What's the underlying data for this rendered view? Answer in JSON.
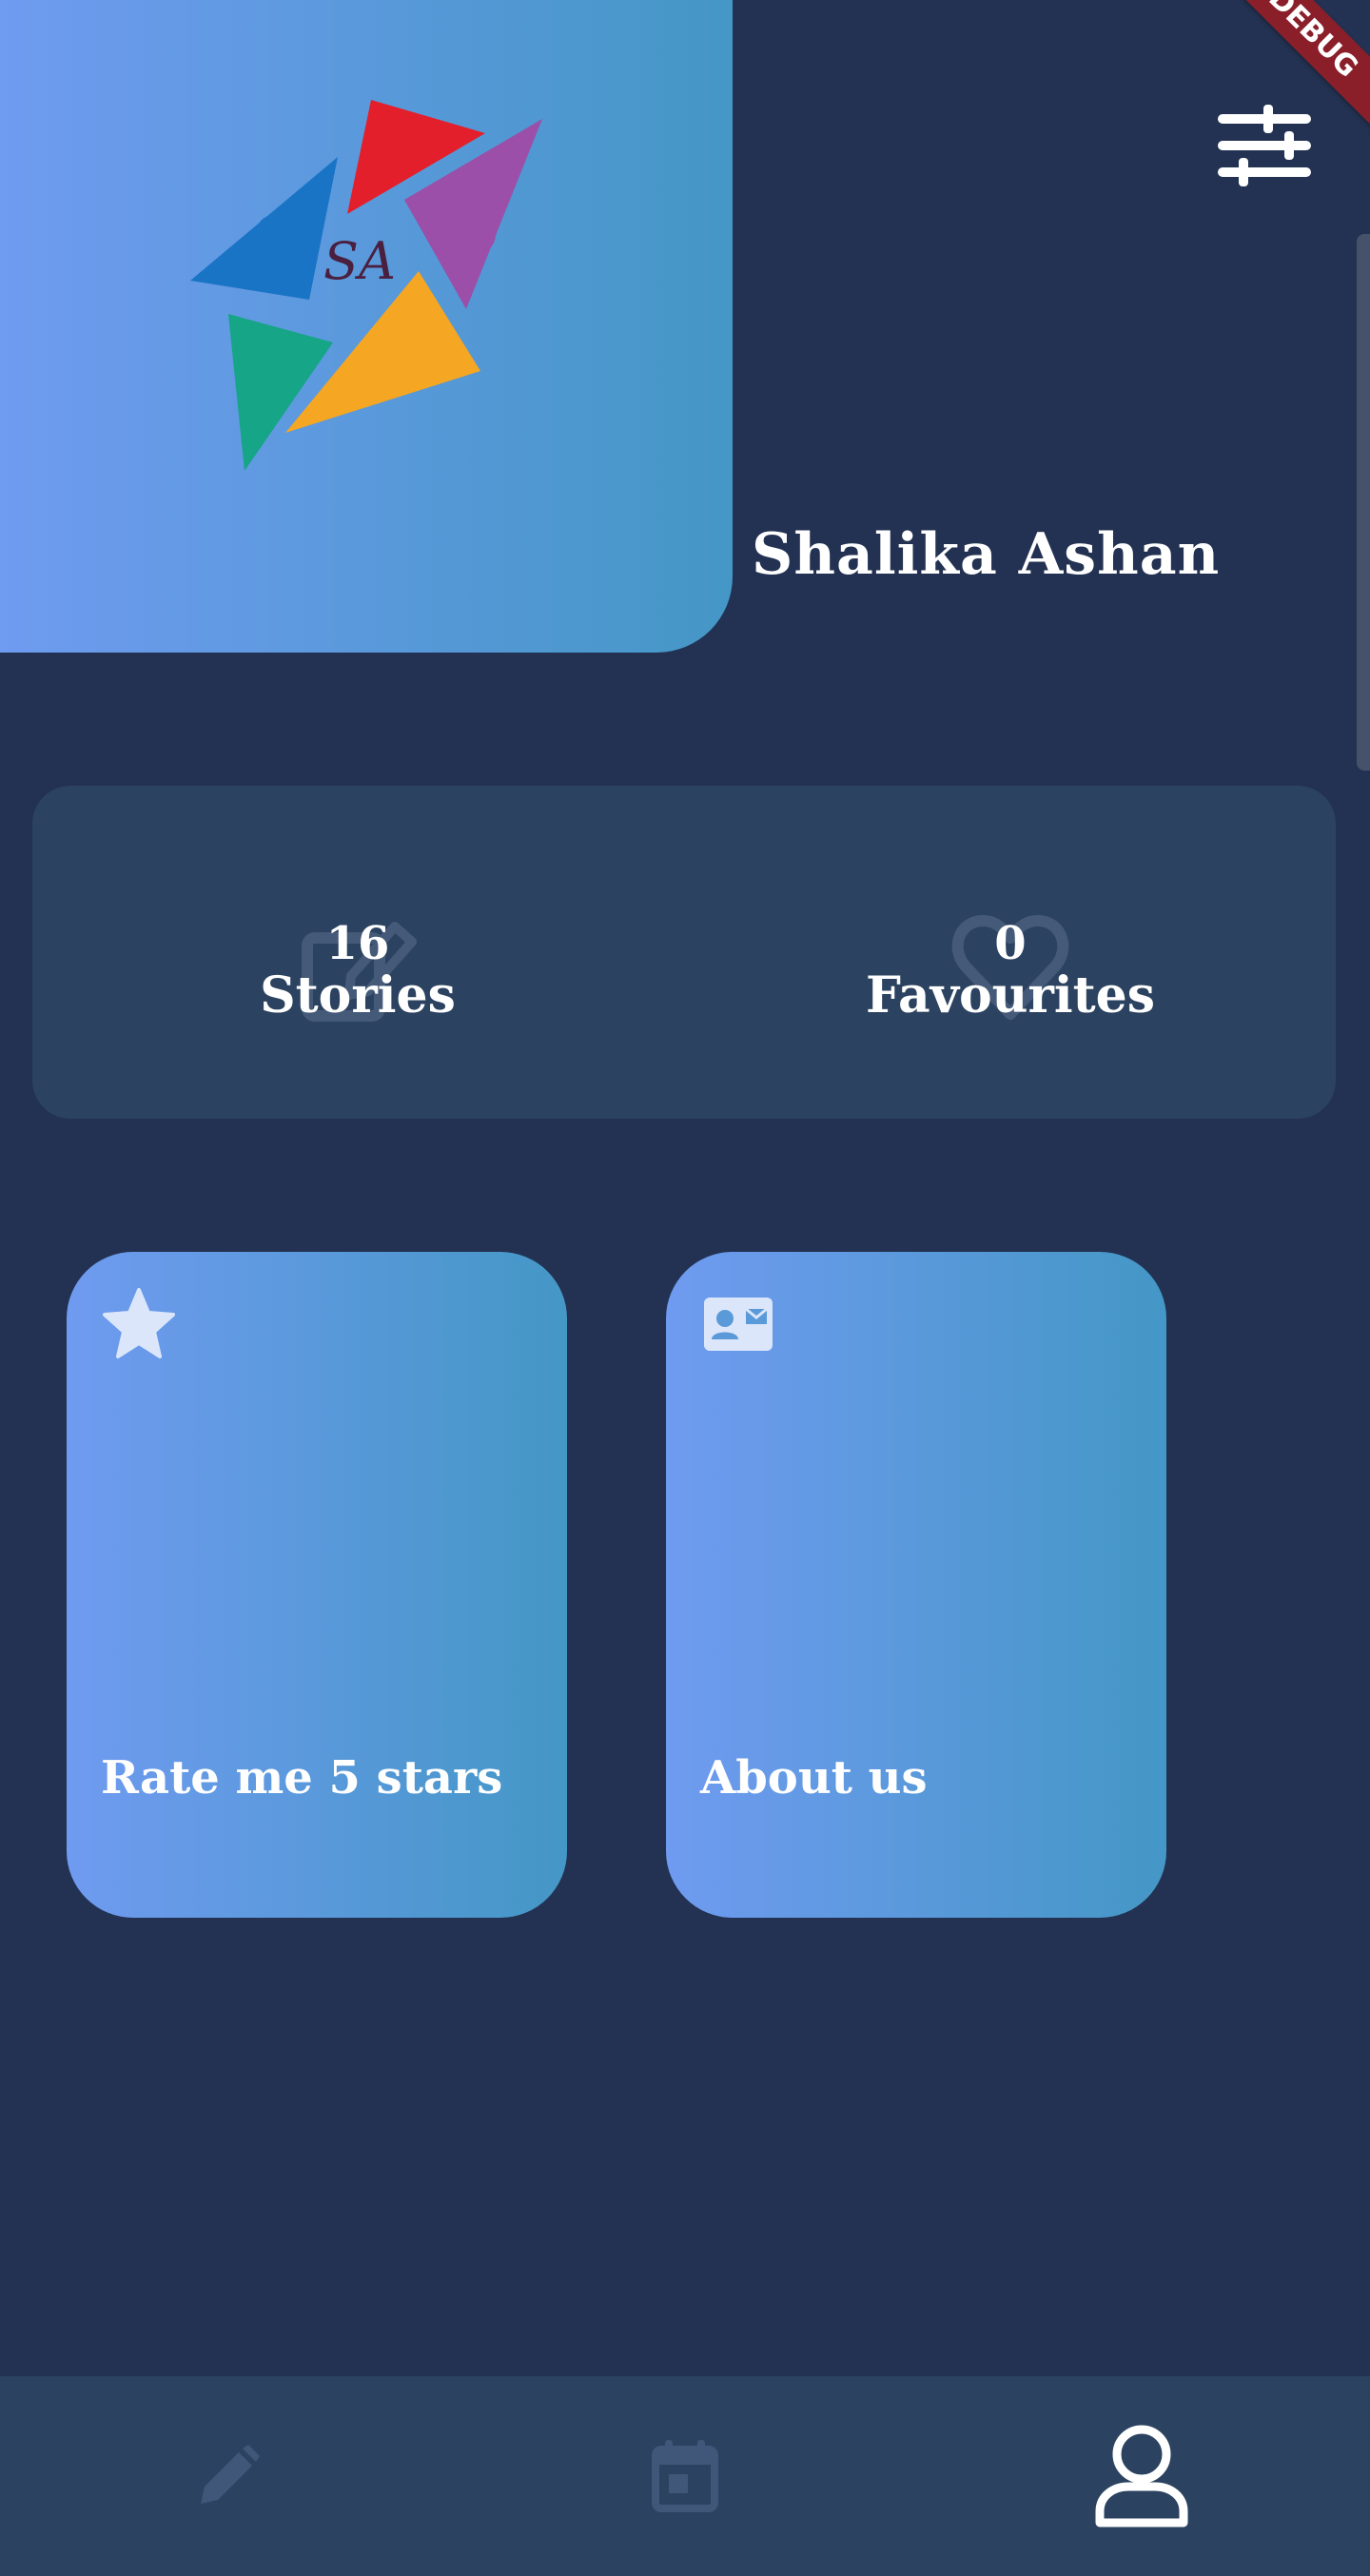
{
  "app": {
    "debug_banner": "DEBUG"
  },
  "profile": {
    "name": "Shalika Ashan",
    "logo_text": "SA",
    "logo_icon": "team-star-logo"
  },
  "header": {
    "settings_icon": "sliders-icon"
  },
  "stats": [
    {
      "count": "16",
      "label": "Stories",
      "icon": "edit-note-icon"
    },
    {
      "count": "0",
      "label": "Favourites",
      "icon": "heart-icon"
    }
  ],
  "cards": [
    {
      "label": "Rate me 5 stars",
      "icon": "star-icon"
    },
    {
      "label": "About us",
      "icon": "contact-card-icon"
    }
  ],
  "bottom_nav": [
    {
      "icon": "pencil-icon",
      "active": false
    },
    {
      "icon": "calendar-icon",
      "active": false
    },
    {
      "icon": "person-icon",
      "active": true
    }
  ],
  "colors": {
    "background": "#233252",
    "panel": "#2b4260",
    "gradient_start": "#6f9bf0",
    "gradient_end": "#4497c6",
    "inactive_icon": "#41577a",
    "text": "#ffffff"
  }
}
